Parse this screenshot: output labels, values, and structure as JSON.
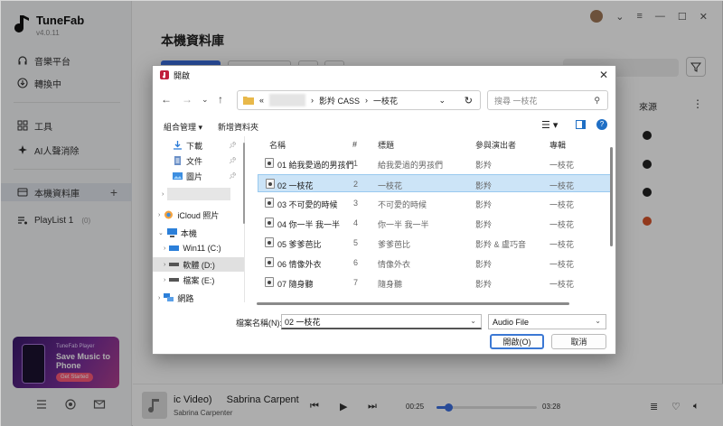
{
  "app": {
    "name": "TuneFab",
    "version": "v4.0.11",
    "accent": "#3b6fe0"
  },
  "sidebar": {
    "items": [
      {
        "label": "音樂平台",
        "icon": "headphones-icon"
      },
      {
        "label": "轉換中",
        "icon": "download-icon"
      },
      {
        "label": "工具",
        "icon": "grid-icon"
      },
      {
        "label": "AI人聲消除",
        "icon": "ai-vocal-icon"
      },
      {
        "label": "本機資料庫",
        "icon": "library-icon"
      },
      {
        "label": "PlayList 1",
        "count": "(0)",
        "icon": "playlist-icon"
      }
    ],
    "promo": {
      "brand": "TuneFab Player",
      "headline": "Save Music to Phone",
      "cta": "Get Started"
    }
  },
  "main": {
    "title": "本機資料庫",
    "column_source": "來源"
  },
  "player": {
    "title_scroll": "ic Video)",
    "title_artist_inline": "Sabrina Carpent",
    "artist": "Sabrina Carpenter",
    "current_time": "00:25",
    "total_time": "03:28",
    "progress_fraction": 0.12
  },
  "dialog": {
    "title": "開啟",
    "address": {
      "prefix": "«",
      "crumbs": [
        "影羚 CASS",
        "一枝花"
      ]
    },
    "search_placeholder": "搜尋 一枝花",
    "commands": {
      "organize": "組合管理 ▾",
      "new_folder": "新增資料夾"
    },
    "tree": [
      {
        "label": "下載",
        "icon": "download-arrow-icon",
        "pinned": true
      },
      {
        "label": "文件",
        "icon": "document-icon",
        "pinned": true
      },
      {
        "label": "圖片",
        "icon": "picture-icon",
        "pinned": true
      },
      {
        "label": "iCloud 照片",
        "icon": "icloud-icon"
      },
      {
        "label": "本機",
        "icon": "pc-icon"
      },
      {
        "label": "Win11 (C:)",
        "icon": "drive-icon"
      },
      {
        "label": "軟體 (D:)",
        "icon": "drive-icon"
      },
      {
        "label": "檔案 (E:)",
        "icon": "drive-icon"
      },
      {
        "label": "網路",
        "icon": "network-icon"
      }
    ],
    "columns": [
      "名稱",
      "#",
      "標題",
      "參與演出者",
      "專輯"
    ],
    "files": [
      {
        "name": "01 給我愛過的男孩們",
        "num": "1",
        "title": "給我愛過的男孩們",
        "artist": "影羚",
        "album": "一枝花"
      },
      {
        "name": "02 一枝花",
        "num": "2",
        "title": "一枝花",
        "artist": "影羚",
        "album": "一枝花"
      },
      {
        "name": "03 不可愛的時候",
        "num": "3",
        "title": "不可愛的時候",
        "artist": "影羚",
        "album": "一枝花"
      },
      {
        "name": "04 你一半 我一半",
        "num": "4",
        "title": "你一半 我一半",
        "artist": "影羚",
        "album": "一枝花"
      },
      {
        "name": "05 爹爹芭比",
        "num": "5",
        "title": "爹爹芭比",
        "artist": "影羚 & 盧巧音",
        "album": "一枝花"
      },
      {
        "name": "06 情像外衣",
        "num": "6",
        "title": "情像外衣",
        "artist": "影羚",
        "album": "一枝花"
      },
      {
        "name": "07 隨身聽",
        "num": "7",
        "title": "隨身聽",
        "artist": "影羚",
        "album": "一枝花"
      }
    ],
    "filename_label": "檔案名稱(N):",
    "filename_value": "02 一枝花",
    "filetype_value": "Audio File",
    "open_label": "開啟(O)",
    "cancel_label": "取消"
  }
}
